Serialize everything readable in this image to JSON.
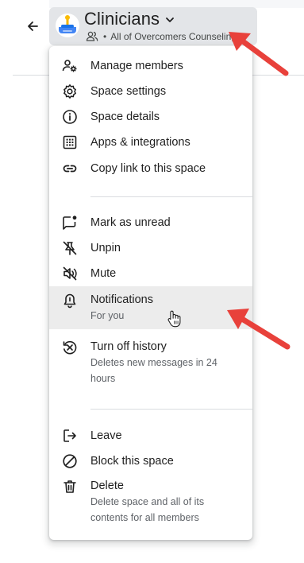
{
  "header": {
    "title": "Clinicians",
    "subtitle": "All of Overcomers Counseling",
    "bullet": "•",
    "back_icon": "arrow-left-icon",
    "avatar_icon": "space-avatar-icon"
  },
  "menu": {
    "items": [
      {
        "label": "Manage members",
        "icon": "manage-members-icon"
      },
      {
        "label": "Space settings",
        "icon": "gear-icon"
      },
      {
        "label": "Space details",
        "icon": "info-icon"
      },
      {
        "label": "Apps & integrations",
        "icon": "apps-grid-icon"
      },
      {
        "label": "Copy link to this space",
        "icon": "link-icon"
      },
      {
        "label": "Mark as unread",
        "icon": "mark-unread-icon"
      },
      {
        "label": "Unpin",
        "icon": "unpin-icon"
      },
      {
        "label": "Mute",
        "icon": "mute-icon"
      },
      {
        "label": "Notifications",
        "desc": "For you",
        "icon": "bell-icon"
      },
      {
        "label": "Turn off history",
        "desc": "Deletes new messages in 24 hours",
        "icon": "history-off-icon"
      },
      {
        "label": "Leave",
        "icon": "leave-icon"
      },
      {
        "label": "Block this space",
        "icon": "block-icon"
      },
      {
        "label": "Delete",
        "desc": "Delete space and all of its contents for all members",
        "icon": "trash-icon"
      }
    ]
  },
  "annotations": {
    "arrow_color": "#e8413b"
  }
}
